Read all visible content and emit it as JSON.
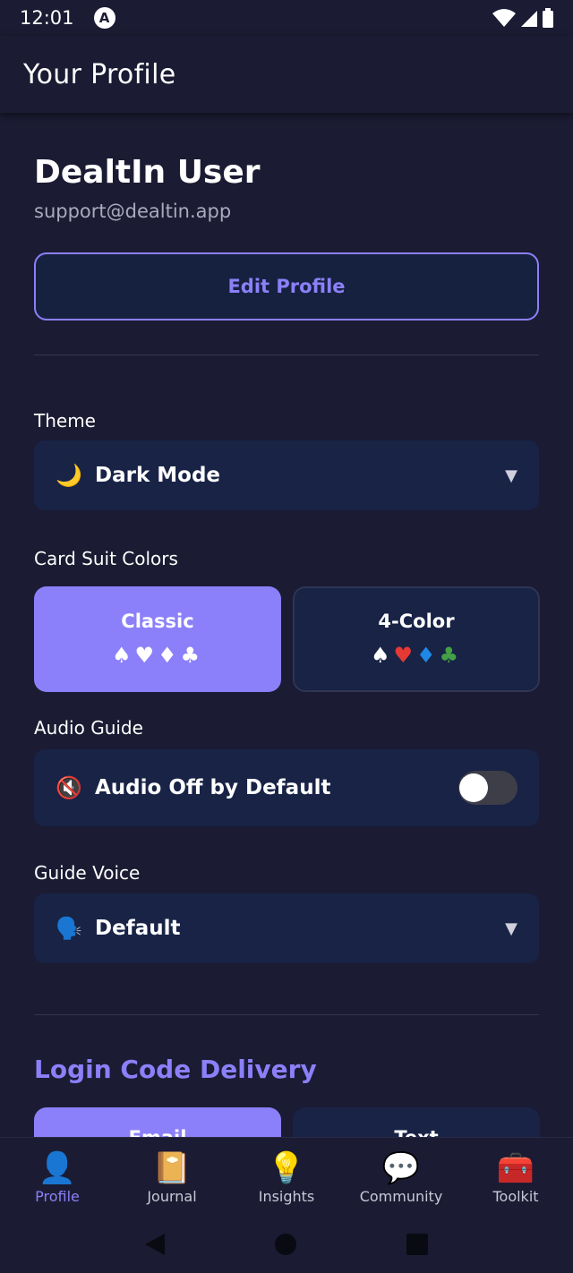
{
  "status": {
    "time": "12:01",
    "app_icon": "A"
  },
  "app_bar": {
    "title": "Your Profile"
  },
  "profile": {
    "name": "DealtIn User",
    "email": "support@dealtin.app",
    "edit_label": "Edit Profile"
  },
  "theme": {
    "label": "Theme",
    "emoji": "🌙",
    "value": "Dark Mode"
  },
  "suits": {
    "label": "Card Suit Colors",
    "classic": {
      "title": "Classic",
      "selected": true
    },
    "four_color": {
      "title": "4-Color",
      "selected": false
    },
    "symbols": [
      "♠",
      "♥",
      "♦",
      "♣"
    ],
    "colors": {
      "spade": "#ffffff",
      "heart": "#e53935",
      "diamond": "#1e88e5",
      "club": "#43a047"
    }
  },
  "audio": {
    "label": "Audio Guide",
    "emoji": "🔇",
    "value": "Audio Off by Default",
    "enabled": false
  },
  "voice": {
    "label": "Guide Voice",
    "emoji": "🗣️",
    "value": "Default"
  },
  "login": {
    "title": "Login Code Delivery",
    "email_label": "Email",
    "text_label": "Text"
  },
  "nav": [
    {
      "label": "Profile",
      "icon": "👤",
      "active": true
    },
    {
      "label": "Journal",
      "icon": "📔",
      "active": false
    },
    {
      "label": "Insights",
      "icon": "💡",
      "active": false
    },
    {
      "label": "Community",
      "icon": "💬",
      "active": false
    },
    {
      "label": "Toolkit",
      "icon": "🧰",
      "active": false
    }
  ],
  "colors": {
    "accent": "#8b80f9",
    "background": "#1b1b33",
    "card": "#182346"
  }
}
